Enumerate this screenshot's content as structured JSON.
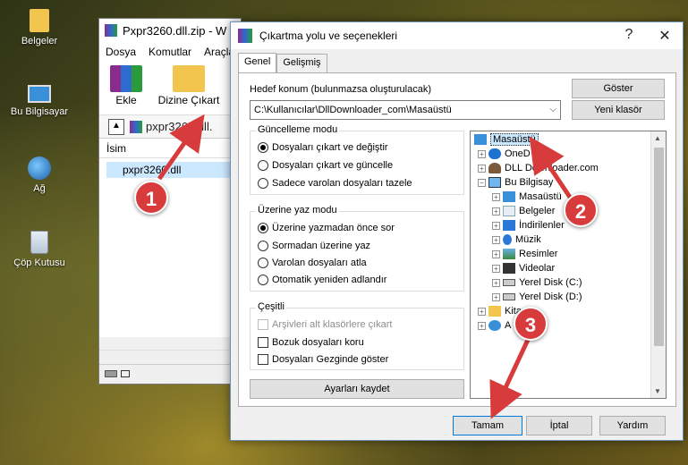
{
  "desktop": {
    "icons": [
      {
        "label": "Belgeler"
      },
      {
        "label": "Bu Bilgisayar"
      },
      {
        "label": "Ağ"
      },
      {
        "label": "Çöp Kutusu"
      }
    ]
  },
  "rar": {
    "title": "Pxpr3260.dll.zip - W",
    "menu": [
      "Dosya",
      "Komutlar",
      "Araçla"
    ],
    "toolbar": {
      "extract_label": "Ekle",
      "extract_to_label": "Dizine Çıkart"
    },
    "address": "pxpr3260.dll.",
    "column_name": "İsim",
    "file": "pxpr3260.dll"
  },
  "dialog": {
    "title": "Çıkartma yolu ve seçenekleri",
    "tabs": [
      "Genel",
      "Gelişmiş"
    ],
    "dest_label": "Hedef konum (bulunmazsa oluşturulacak)",
    "dest_value": "C:\\Kullanıcılar\\DllDownloader_com\\Masaüstü",
    "btn_show": "Göster",
    "btn_new_folder": "Yeni klasör",
    "update_group": {
      "title": "Güncelleme modu",
      "options": [
        "Dosyaları çıkart ve değiştir",
        "Dosyaları çıkart ve güncelle",
        "Sadece varolan dosyaları tazele"
      ],
      "selected": 0
    },
    "overwrite_group": {
      "title": "Üzerine yaz modu",
      "options": [
        "Üzerine yazmadan önce sor",
        "Sormadan üzerine yaz",
        "Varolan dosyaları atla",
        "Otomatik yeniden adlandır"
      ],
      "selected": 0
    },
    "misc_group": {
      "title": "Çeşitli",
      "options": [
        "Arşivleri alt klasörlere çıkart",
        "Bozuk dosyaları koru",
        "Dosyaları Gezginde göster"
      ]
    },
    "btn_save": "Ayarları kaydet",
    "tree": [
      {
        "label": "Masaüstü",
        "icon": "desktop-icon"
      },
      {
        "label": "OneD",
        "icon": "cloud-icon"
      },
      {
        "label": "DLL Downloader.com",
        "icon": "person-icon"
      },
      {
        "label": "Bu Bilgisay",
        "icon": "pc-icon"
      },
      {
        "label": "Masaüstü",
        "icon": "desktop-icon"
      },
      {
        "label": "Belgeler",
        "icon": "document-icon"
      },
      {
        "label": "İndirilenler",
        "icon": "download-icon"
      },
      {
        "label": "Müzik",
        "icon": "music-icon"
      },
      {
        "label": "Resimler",
        "icon": "pictures-icon"
      },
      {
        "label": "Videolar",
        "icon": "video-icon"
      },
      {
        "label": "Yerel Disk (C:)",
        "icon": "disk-icon"
      },
      {
        "label": "Yerel Disk (D:)",
        "icon": "disk-icon"
      },
      {
        "label": "Kitap",
        "icon": "library-icon"
      },
      {
        "label": "A",
        "icon": "network-icon"
      }
    ],
    "btn_ok": "Tamam",
    "btn_cancel": "İptal",
    "btn_help": "Yardım"
  },
  "callouts": [
    "1",
    "2",
    "3"
  ],
  "colors": {
    "callout": "#d83b3b",
    "selection": "#cce8ff"
  }
}
